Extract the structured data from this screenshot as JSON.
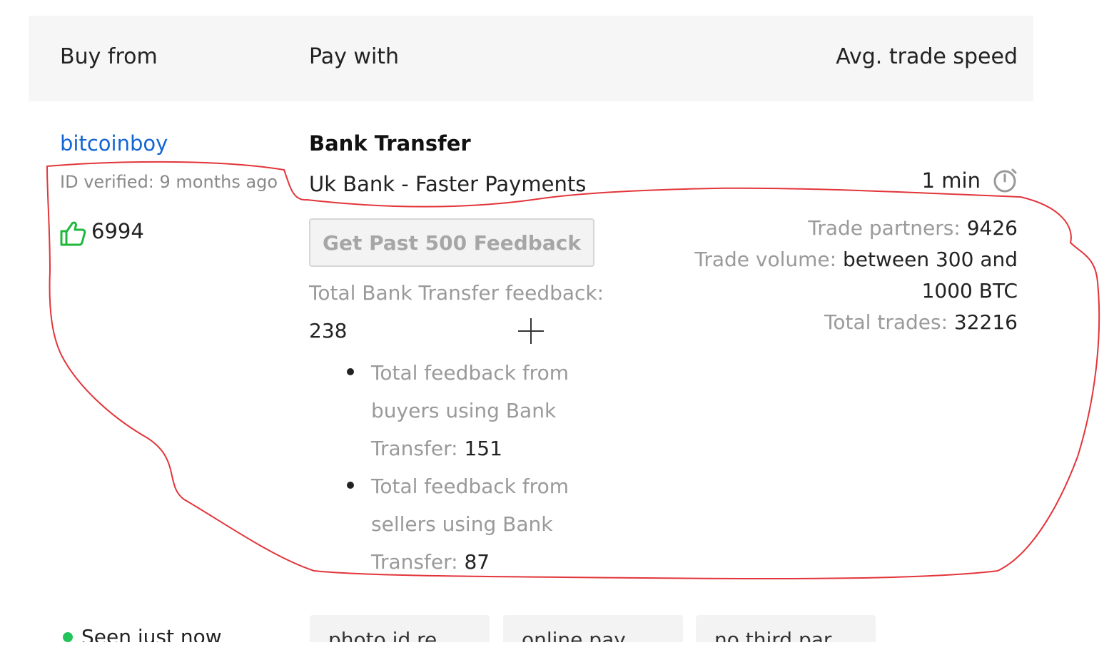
{
  "table_header": {
    "buy_from": "Buy from",
    "pay_with": "Pay with",
    "avg_trade_speed": "Avg. trade speed"
  },
  "seller": {
    "username": "bitcoinboy",
    "id_verified": "ID verified: 9 months ago",
    "feedback_score": "6994",
    "status": "Seen just now",
    "status_color": "#21c45a"
  },
  "payment": {
    "method_title": "Bank Transfer",
    "method_detail": "Uk Bank - Faster Payments",
    "feedback_button_label": "Get Past 500 Feedback",
    "total_feedback_label": "Total Bank Transfer feedback:",
    "total_feedback_value": "238",
    "breakdown": [
      {
        "label": "Total feedback from buyers using Bank Transfer:",
        "value": "151"
      },
      {
        "label": "Total feedback from sellers using Bank Transfer:",
        "value": "87"
      }
    ]
  },
  "trade": {
    "speed": "1 min",
    "partners_label": "Trade partners:",
    "partners_value": "9426",
    "volume_label": "Trade volume:",
    "volume_value": "between 300 and 1000 BTC",
    "total_label": "Total trades:",
    "total_value": "32216"
  },
  "tags": [
    "photo id re",
    "online pay",
    "no third par"
  ],
  "colors": {
    "link": "#1266d4",
    "thumbs_up": "#1fb83c",
    "annotation": "#e2353a",
    "header_background": "#f6f6f6",
    "muted_text": "#9a9a9a"
  },
  "icons": {
    "feedback": "thumbs-up-icon",
    "speed": "timer-icon",
    "cursor": "crosshair-cursor-icon"
  }
}
